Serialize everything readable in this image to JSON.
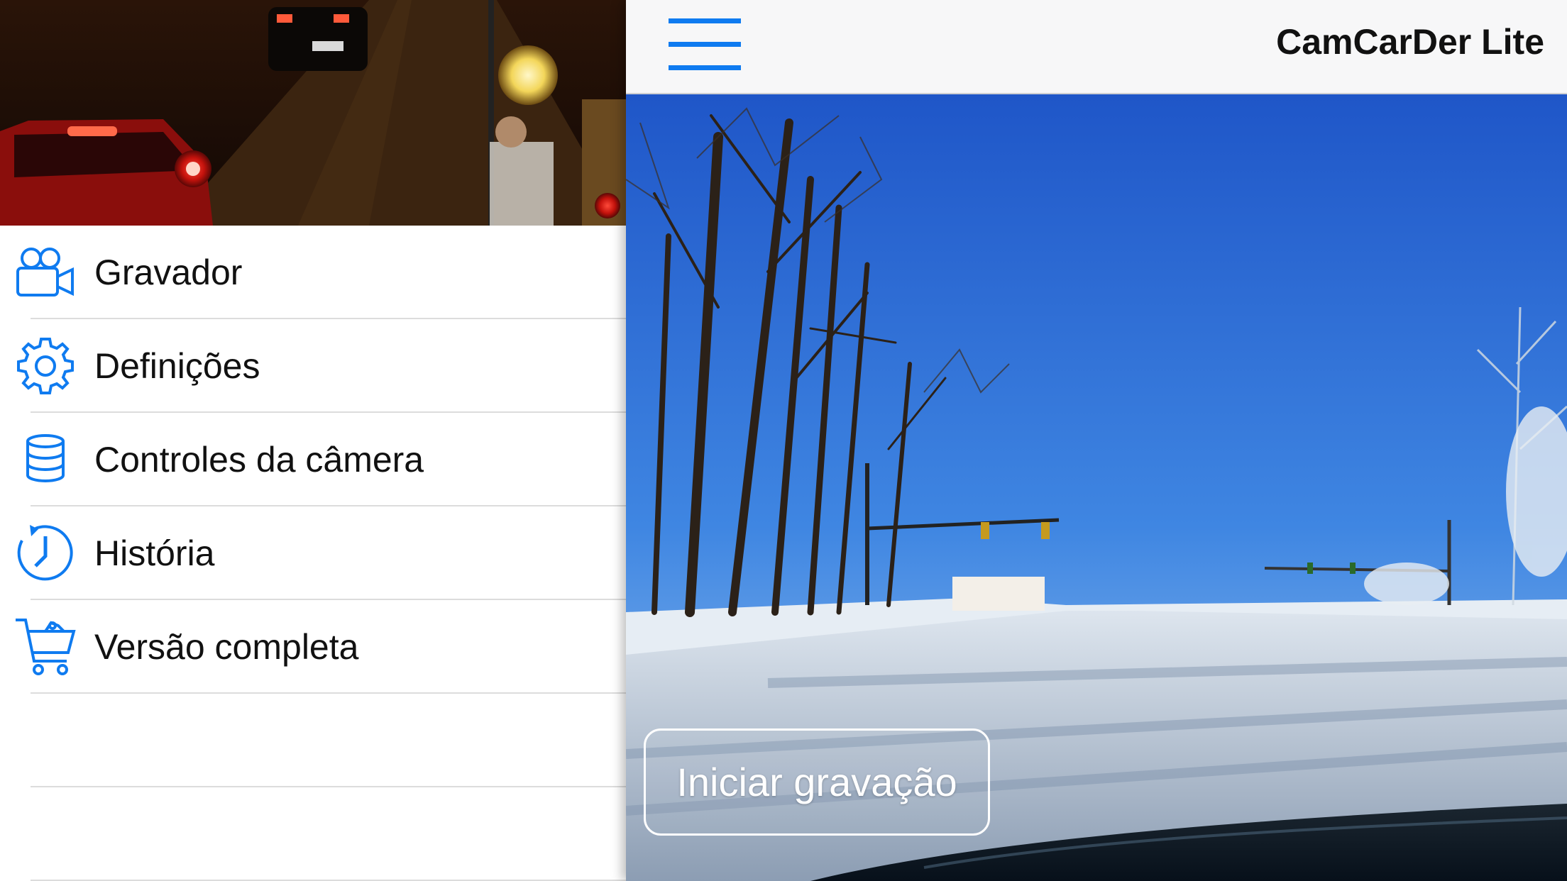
{
  "app": {
    "title": "CamCarDer Lite"
  },
  "menu": {
    "items": [
      {
        "label": "Gravador",
        "icon": "video-camera-icon"
      },
      {
        "label": "Definições",
        "icon": "gear-icon"
      },
      {
        "label": "Controles da câmera",
        "icon": "lens-stack-icon"
      },
      {
        "label": "História",
        "icon": "clock-history-icon"
      },
      {
        "label": "Versão completa",
        "icon": "shopping-cart-icon"
      }
    ]
  },
  "camera": {
    "record_label": "Iniciar gravação"
  },
  "colors": {
    "accent": "#0f7bf0",
    "navbar_bg": "#f7f7f8",
    "separator": "#dcdcdc"
  }
}
